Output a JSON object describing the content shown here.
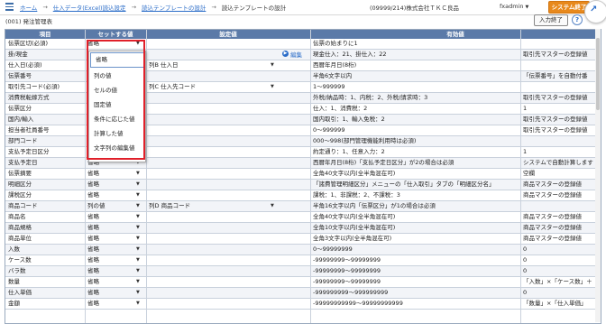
{
  "header": {
    "breadcrumbs": [
      "ホーム",
      "仕入データ(Excel)読込設定",
      "読込テンプレートの設計",
      "読込テンプレートの設計"
    ],
    "separator": "→",
    "company": "(09999/214)株式会社ＴＫＣ良品",
    "user": "fxadmin",
    "system_end_label": "システム終了"
  },
  "subheader": {
    "subtitle": "(001) 発注管理表",
    "input_end_label": "入力終了",
    "help_label": "?"
  },
  "table": {
    "columns": [
      "項目",
      "セットする値",
      "設定値",
      "有効値"
    ],
    "edit_label": "編集",
    "rows": [
      {
        "item": "伝票区切(必須)",
        "set": "省略",
        "setting": "",
        "valid": "伝票の始まりに1",
        "valid2": ""
      },
      {
        "item": "掛/現金",
        "set": "省略",
        "setting": "",
        "valid": "現金仕入：21、掛仕入：22",
        "valid2": "取引先マスターの登録値"
      },
      {
        "item": "仕入日(必須)",
        "set": "列の値",
        "setting": "列B 仕入日",
        "valid": "西暦年月日(8桁)",
        "valid2": ""
      },
      {
        "item": "伝票番号",
        "set": "セルの値",
        "setting": "",
        "valid": "半角6文字以内",
        "valid2": "「伝票番号」を自動付番"
      },
      {
        "item": "取引先コード(必須)",
        "set": "固定値",
        "setting": "列C 仕入先コード",
        "valid": "1～999999",
        "valid2": ""
      },
      {
        "item": "消費税転嫁方式",
        "set": "条件に応じた値",
        "setting": "",
        "valid": "外税/納品時：1、内税：2、外税/請求時：3",
        "valid2": "取引先マスターの登録値"
      },
      {
        "item": "伝票区分",
        "set": "計算した値",
        "setting": "",
        "valid": "仕入：1、消費税：2",
        "valid2": "1"
      },
      {
        "item": "国内/輸入",
        "set": "文字列の編集値",
        "setting": "",
        "valid": "国内取引：1、輸入免税：2",
        "valid2": "取引先マスターの登録値"
      },
      {
        "item": "担当者社員番号",
        "set": "省略",
        "setting": "",
        "valid": "0～999999",
        "valid2": "取引先マスターの登録値"
      },
      {
        "item": "部門コード",
        "set": "",
        "setting": "",
        "valid": "000～998(部門管理機能利用時は必須)",
        "valid2": ""
      },
      {
        "item": "支払予定日区分",
        "set": "省略",
        "setting": "",
        "valid": "約定通り：1、任意入力：2",
        "valid2": "1"
      },
      {
        "item": "支払予定日",
        "set": "省略",
        "setting": "",
        "valid": "西暦年月日(8桁)「支払予定日区分」が2の場合は必須",
        "valid2": "システムで自動計算します"
      },
      {
        "item": "伝票摘要",
        "set": "省略",
        "setting": "",
        "valid": "全角40文字以内(全半角混在可)",
        "valid2": "空欄"
      },
      {
        "item": "明細区分",
        "set": "省略",
        "setting": "",
        "valid": "「諸費管理明細区分」メニューの「仕入取引」タブの「明細区分名」",
        "valid2": "商品マスターの登録値"
      },
      {
        "item": "課税区分",
        "set": "省略",
        "setting": "",
        "valid": "課税：1、非課税：2、不課税：3",
        "valid2": "商品マスターの登録値"
      },
      {
        "item": "商品コード",
        "set": "列の値",
        "setting": "列D 商品コード",
        "valid": "半角16文字以内「伝票区分」が1の場合は必須",
        "valid2": ""
      },
      {
        "item": "商品名",
        "set": "省略",
        "setting": "",
        "valid": "全角40文字以内(全半角混在可)",
        "valid2": "商品マスターの登録値"
      },
      {
        "item": "商品規格",
        "set": "省略",
        "setting": "",
        "valid": "全角10文字以内(全半角混在可)",
        "valid2": "商品マスターの登録値"
      },
      {
        "item": "商品単位",
        "set": "省略",
        "setting": "",
        "valid": "全角3文字以内(全半角混在可)",
        "valid2": "商品マスターの登録値"
      },
      {
        "item": "入数",
        "set": "省略",
        "setting": "",
        "valid": "0～99999999",
        "valid2": "0"
      },
      {
        "item": "ケース数",
        "set": "省略",
        "setting": "",
        "valid": "-99999999～99999999",
        "valid2": "0"
      },
      {
        "item": "バラ数",
        "set": "省略",
        "setting": "",
        "valid": "-99999999～99999999",
        "valid2": "0"
      },
      {
        "item": "数量",
        "set": "省略",
        "setting": "",
        "valid": "-99999999～99999999",
        "valid2": "「入数」×「ケース数」＋"
      },
      {
        "item": "仕入単価",
        "set": "省略",
        "setting": "",
        "valid": "-999999999～999999999",
        "valid2": "0"
      },
      {
        "item": "金額",
        "set": "省略",
        "setting": "",
        "valid": "-99999999999～99999999999",
        "valid2": "「数量」×「仕入単価」"
      }
    ]
  },
  "dropdown": {
    "options": [
      "省略",
      "列の値",
      "セルの値",
      "固定値",
      "条件に応じた値",
      "計算した値",
      "文字列の編集値"
    ]
  },
  "colors": {
    "header_bg": "#5b7aa8",
    "accent": "#2a6cc8",
    "system_end": "#e8891c",
    "highlight": "#e0202a"
  }
}
